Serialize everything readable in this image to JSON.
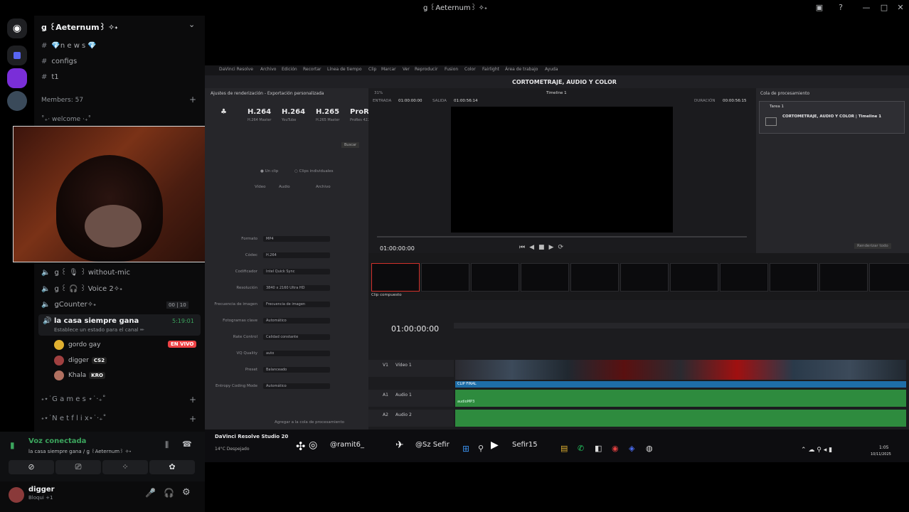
{
  "window": {
    "title": "ǥ ꒰Aeternum꒱ ✧˖"
  },
  "server": {
    "name": "ǥ ꒰Aeternum꒱ ✧˖"
  },
  "channels": [
    {
      "name": "💎n e w s 💎"
    },
    {
      "name": "configs"
    },
    {
      "name": "t1"
    }
  ],
  "members_label": "Members: 57",
  "welcome_label": "˚₊‧ welcome ‧₊˚",
  "voice_channels": [
    {
      "name": "ǥ ꒰ 🎙 ꒱ without-mic"
    },
    {
      "name": "ǥ ꒰ 🎧 ꒱ Voice 2✧˖"
    },
    {
      "name": "ǥCounter✧˖",
      "count_left": "00",
      "count_right": "10"
    }
  ],
  "active_channel": {
    "name": "la casa siempre gana",
    "time": "5:19:01",
    "status": "Establece un estado para el canal ✏"
  },
  "voice_users": [
    {
      "name": "gordo gay"
    },
    {
      "name": "digger",
      "badge": "CS2"
    },
    {
      "name": "Khala",
      "badge": "KRO"
    }
  ],
  "live_badge": "EN VIVO",
  "categories": [
    {
      "name": "˖⋆˙G a m e s ⋆˙‧₊˚"
    },
    {
      "name": "˖⋆˙N e t f l i x⋆˙‧₊˚"
    }
  ],
  "voice_status": {
    "title": "Voz conectada",
    "subtitle": "la casa siempre gana / ǥ ꒰Aeternum꒱ ✧˖"
  },
  "user": {
    "name": "digger",
    "status": "Bloqui +1"
  },
  "resolve": {
    "menu": [
      "DaVinci Resolve",
      "Archivo",
      "Edición",
      "Recortar",
      "Línea de tiempo",
      "Clip",
      "Marcar",
      "Ver",
      "Reproducir",
      "Fusion",
      "Color",
      "Fairlight",
      "Área de trabajo",
      "Ayuda"
    ],
    "project_title": "CORTOMETRAJE, AUDIO Y COLOR",
    "settings_header": "Ajustes de renderización - Exportación personalizada",
    "codecs": [
      {
        "name": "H.264",
        "sub": "H.264 Master"
      },
      {
        "name": "H.264",
        "sub": "YouTube"
      },
      {
        "name": "H.265",
        "sub": "H.265 Master"
      },
      {
        "name": "ProRes",
        "sub": "ProRes 422"
      }
    ],
    "timeline_name": "Timeline 1",
    "zoom": "31%",
    "entrada_label": "ENTRADA",
    "entrada_value": "01:00:00:00",
    "salida_label": "SALIDA",
    "salida_value": "01:00:56:14",
    "duracion_label": "DURACIÓN",
    "duracion_value": "00:00:56:15",
    "timecode": "01:00:00:00",
    "queue_header": "Cola de procesamiento",
    "queue_job": "Tarea 1",
    "queue_item": "CORTOMETRAJE, AUDIO Y COLOR | Timeline 1",
    "render_all": "Renderizar todo",
    "clip_compuesto": "Clip compuesto",
    "timeline_timecode": "01:00:00:00",
    "tracks": [
      {
        "id": "V1",
        "name": "Vídeo 1"
      },
      {
        "id": "A1",
        "name": "Audio 1"
      },
      {
        "id": "A2",
        "name": "Audio 2"
      }
    ],
    "clip_final": "CLIP FINAL",
    "audio_clip": "audioMP3",
    "settings_fields": [
      {
        "label": "Formato",
        "value": "MP4"
      },
      {
        "label": "Códec",
        "value": "H.264"
      },
      {
        "label": "Codificador",
        "value": "Intel Quick Sync"
      },
      {
        "label": "Resolución",
        "value": "3840 x 2160 Ultra HD"
      },
      {
        "label": "Frecuencia de imagen",
        "value": "Frecuencia de imagen"
      },
      {
        "label": "Fotogramas clave",
        "value": "Automático"
      },
      {
        "label": "Rate Control",
        "value": "Calidad constante"
      },
      {
        "label": "VQ Quality",
        "value": "auto"
      },
      {
        "label": "Preset",
        "value": "Balanceado"
      },
      {
        "label": "Entropy Coding Mode",
        "value": "Automático"
      }
    ],
    "add_queue": "Agregar a la cola de procesamiento",
    "single_clip": "Un clip",
    "individual_clips": "Clips individuales",
    "video_tab": "Vídeo",
    "audio_tab": "Audio",
    "file_tab": "Archivo",
    "browse": "Buscar"
  },
  "taskbar": {
    "app": "DaVinci Resolve Studio 20",
    "weather": "14°C Despejado",
    "instagram": "@ramit6_",
    "twitter": "@Sz Sefir",
    "youtube": "Sefir15",
    "clock": "1:05",
    "date": "10/11/2025"
  },
  "colors": {
    "accent_green": "#3ba55d",
    "live_red": "#ed4245",
    "clip_blue": "#1e6ea8",
    "audio_green": "#2e8b3e"
  }
}
